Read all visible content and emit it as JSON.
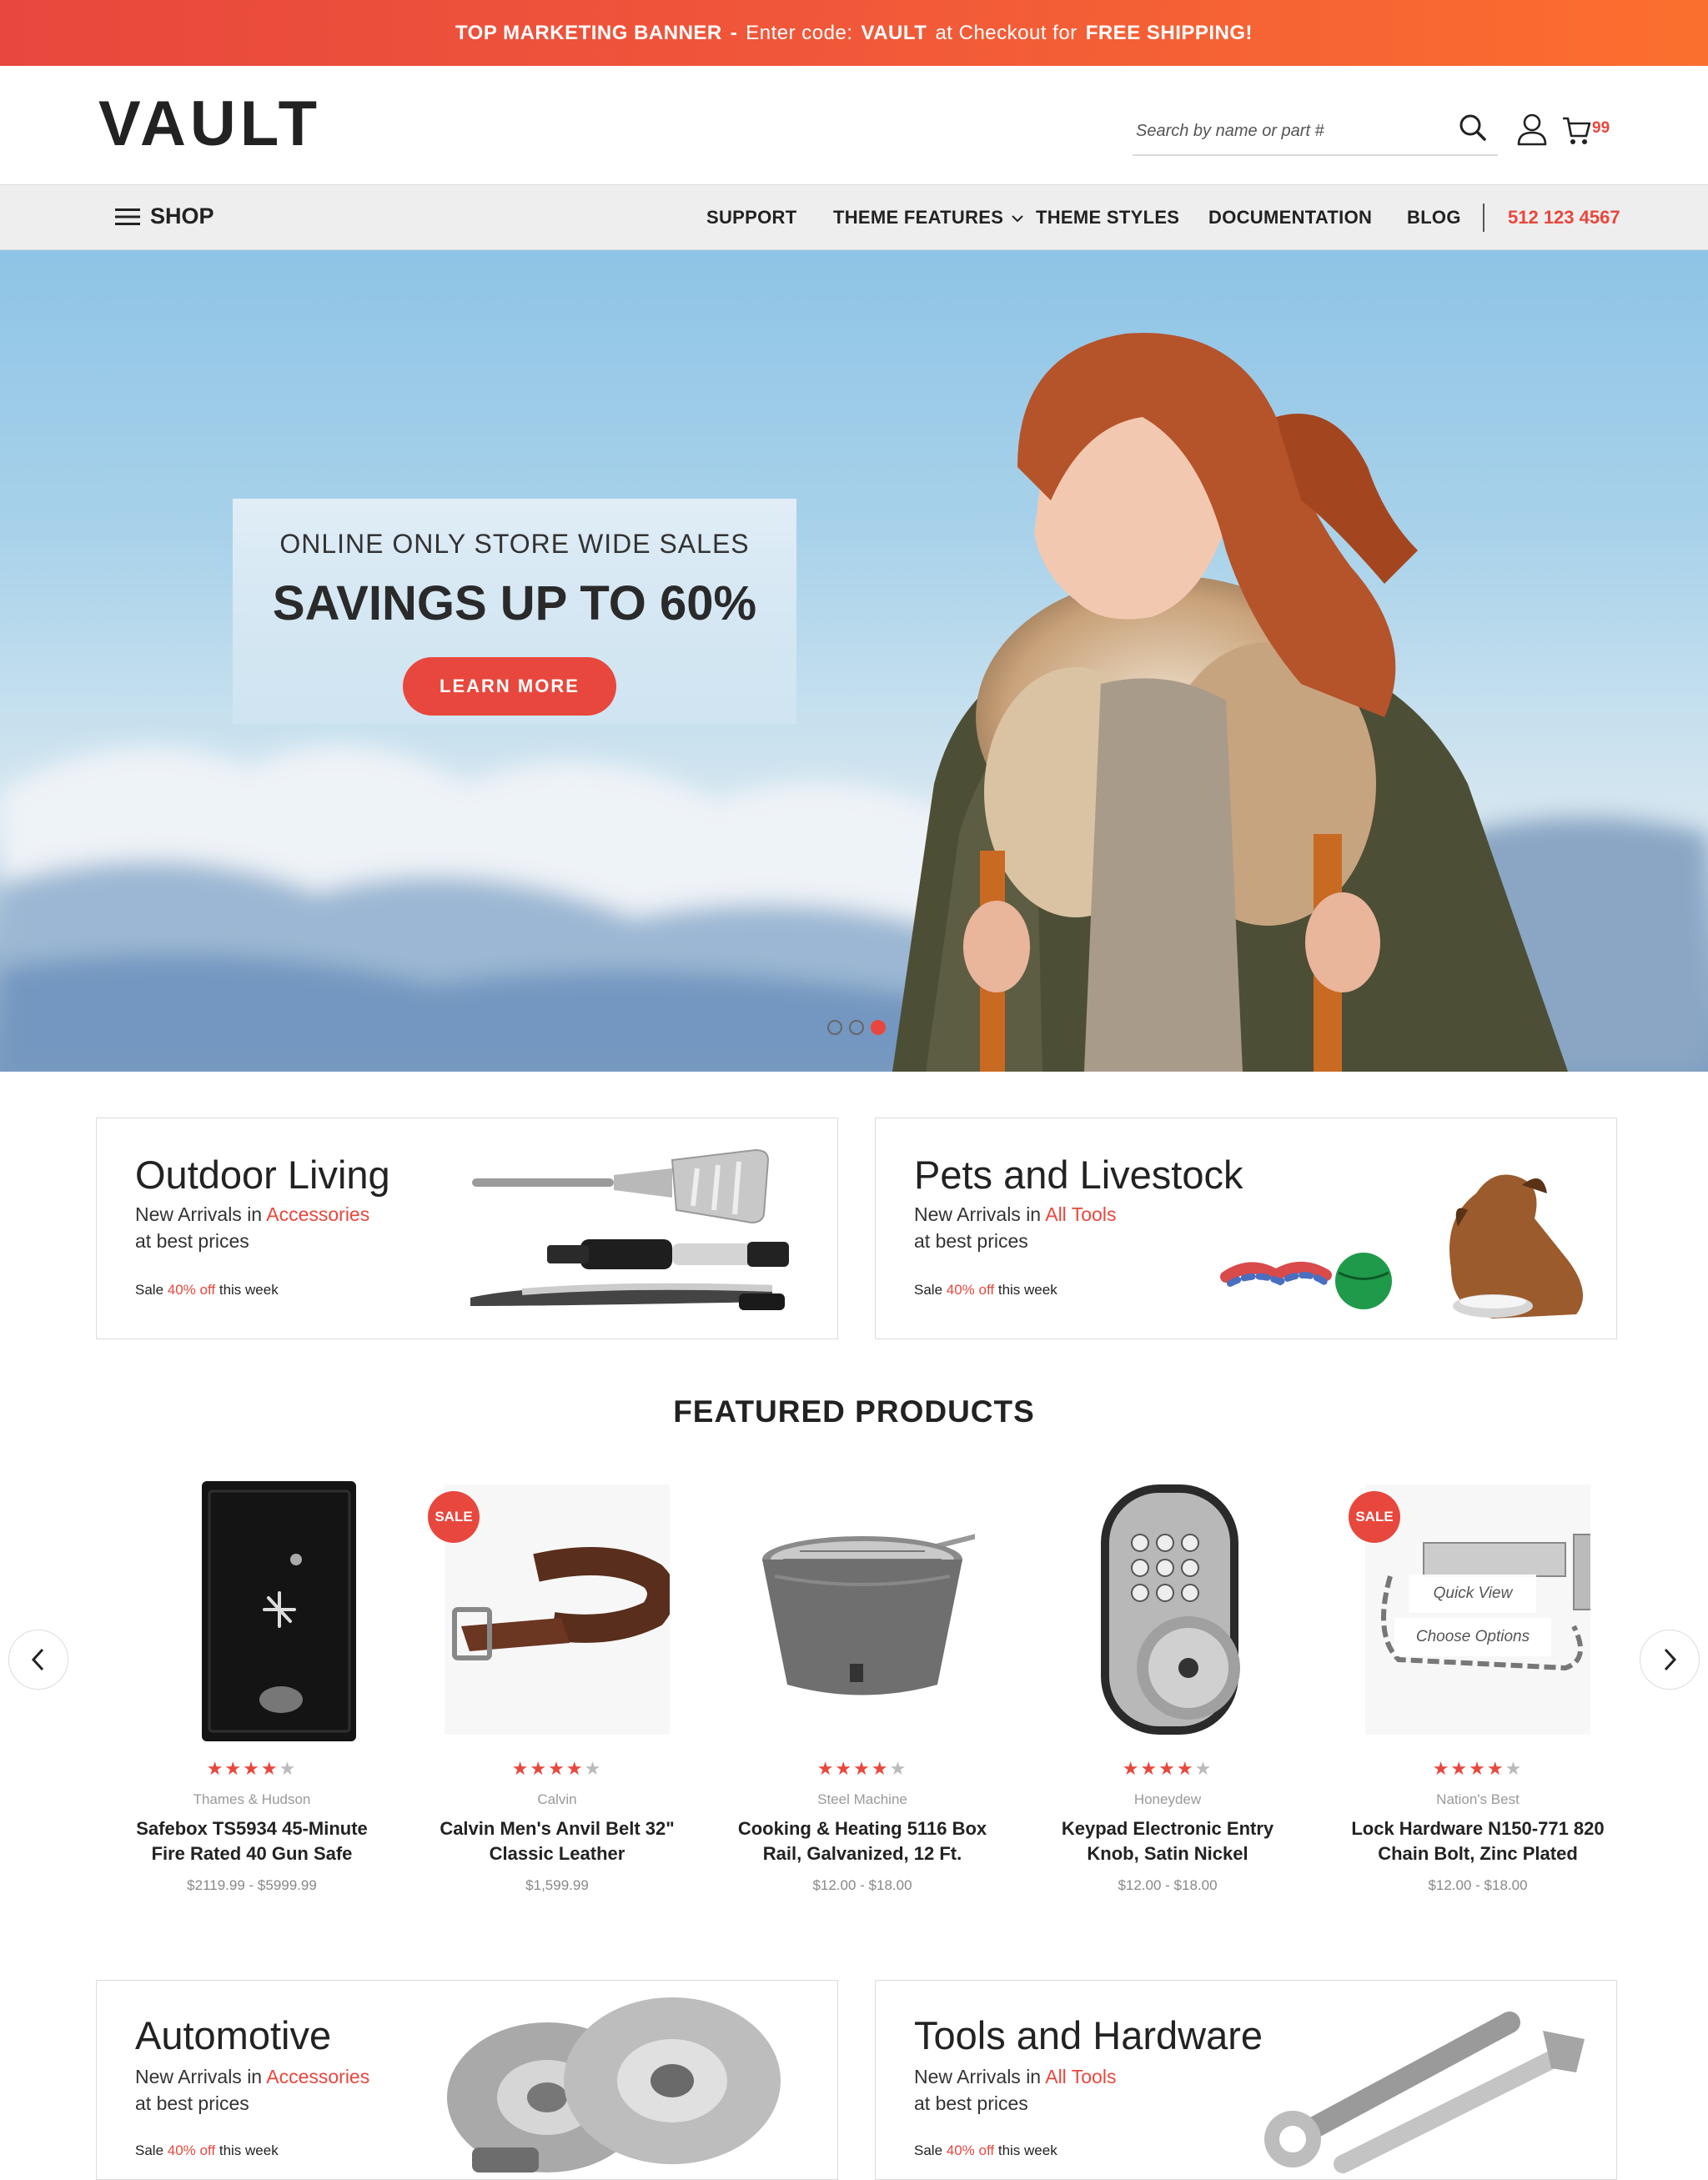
{
  "banner": {
    "label": "TOP MARKETING BANNER",
    "dash": "-",
    "pre": "Enter code:",
    "code": "VAULT",
    "mid": "at Checkout for",
    "offer": "FREE SHIPPING!"
  },
  "header": {
    "logo": "VAULT",
    "search_placeholder": "Search by name or part #",
    "cart_count": "99"
  },
  "nav": {
    "shop": "SHOP",
    "items": [
      "SUPPORT",
      "THEME FEATURES",
      "THEME STYLES",
      "DOCUMENTATION",
      "BLOG"
    ],
    "phone": "512 123 4567"
  },
  "hero": {
    "subtitle": "ONLINE ONLY STORE WIDE SALES",
    "title": "SAVINGS UP TO 60%",
    "cta": "LEARN MORE",
    "slides": 3,
    "active_slide": 3
  },
  "categories": [
    {
      "title": "Outdoor Living",
      "line1_pre": "New Arrivals in",
      "line1_link": "Accessories",
      "line2": "at best prices",
      "sale_pre": "Sale",
      "sale_pct": "40% off",
      "sale_post": "this week"
    },
    {
      "title": "Pets and Livestock",
      "line1_pre": "New Arrivals in",
      "line1_link": "All Tools",
      "line2": "at best prices",
      "sale_pre": "Sale",
      "sale_pct": "40% off",
      "sale_post": "this week"
    },
    {
      "title": "Automotive",
      "line1_pre": "New Arrivals in",
      "line1_link": "Accessories",
      "line2": "at best prices",
      "sale_pre": "Sale",
      "sale_pct": "40% off",
      "sale_post": "this week"
    },
    {
      "title": "Tools and Hardware",
      "line1_pre": "New Arrivals in",
      "line1_link": "All Tools",
      "line2": "at best prices",
      "sale_pre": "Sale",
      "sale_pct": "40% off",
      "sale_post": "this week"
    }
  ],
  "featured": {
    "title": "FEATURED PRODUCTS",
    "sale_label": "SALE",
    "quick_view": "Quick View",
    "choose_options": "Choose Options",
    "products": [
      {
        "brand": "Thames & Hudson",
        "name1": "Safebox TS5934 45-Minute",
        "name2": "Fire Rated 40 Gun Safe",
        "price": "$2119.99 - $5999.99",
        "rating": 4,
        "sale": false
      },
      {
        "brand": "Calvin",
        "name1": "Calvin Men's Anvil Belt 32\"",
        "name2": "Classic Leather",
        "price": "$1,599.99",
        "rating": 4,
        "sale": true
      },
      {
        "brand": "Steel Machine",
        "name1": "Cooking & Heating 5116 Box",
        "name2": "Rail, Galvanized, 12 Ft.",
        "price": "$12.00 - $18.00",
        "rating": 4,
        "sale": false
      },
      {
        "brand": "Honeydew",
        "name1": "Keypad Electronic Entry",
        "name2": "Knob, Satin Nickel",
        "price": "$12.00 - $18.00",
        "rating": 4,
        "sale": false
      },
      {
        "brand": "Nation's Best",
        "name1": "Lock Hardware N150-771 820",
        "name2": "Chain Bolt, Zinc Plated",
        "price": "$12.00 - $18.00",
        "rating": 4,
        "sale": true
      }
    ]
  },
  "colors": {
    "accent": "#e8473d",
    "banner_end": "#fb6f2e",
    "nav_bg": "#eeeeee"
  }
}
